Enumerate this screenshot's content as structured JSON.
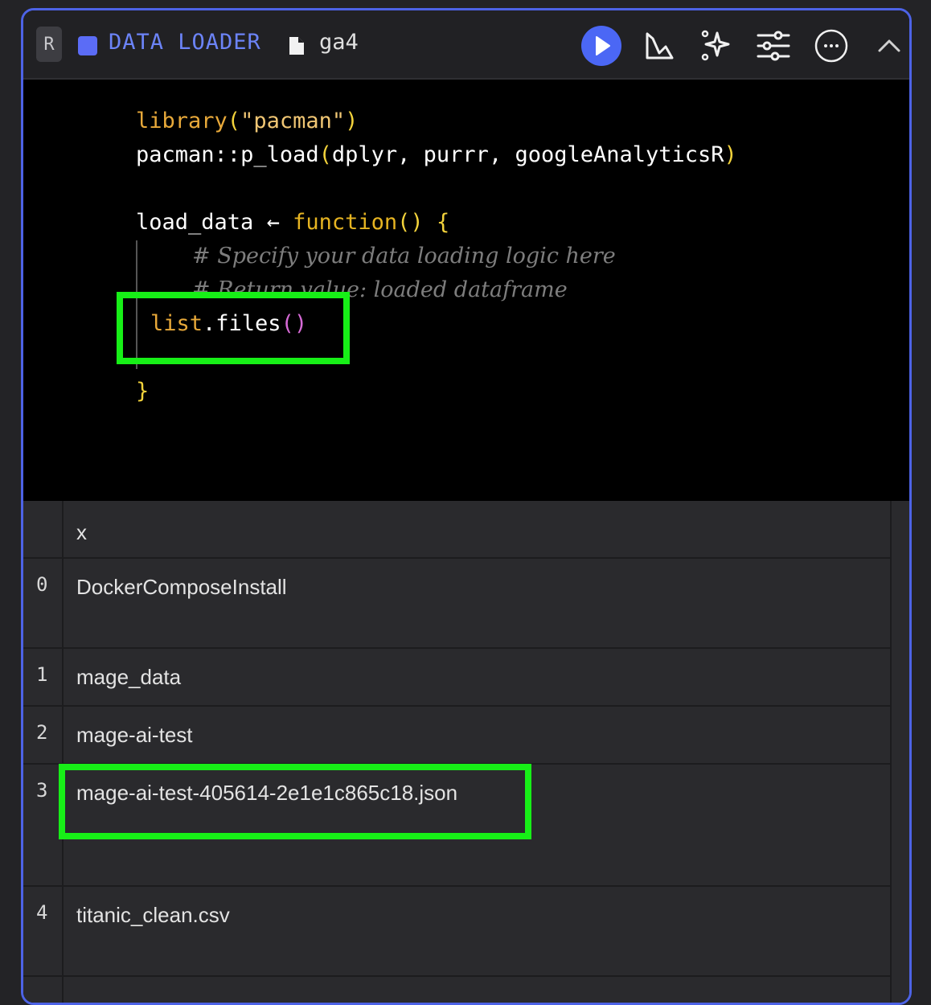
{
  "header": {
    "language_badge": "R",
    "block_type": "DATA LOADER",
    "block_name": "ga4",
    "icons": [
      "file-icon",
      "run-icon",
      "chart-icon",
      "ai-sparkle-icon",
      "settings-sliders-icon",
      "more-options-icon",
      "chevron-up-icon"
    ],
    "accent_color": "#5b6cf6"
  },
  "code": {
    "line1_fn": "library",
    "line1_arg": "\"pacman\"",
    "line2_pkg": "pacman",
    "line2_op": "::",
    "line2_fn": "p_load",
    "line2_args": "dplyr, purrr, googleAnalyticsR",
    "line4_var": "load_data",
    "line4_arrow": "←",
    "line4_kw": "function",
    "comment1": "# Specify your data loading logic here",
    "comment2": "# Return value: loaded dataframe",
    "call_fn": "list",
    "call_method": ".files",
    "call_parens": "()",
    "closing_brace": "}"
  },
  "output": {
    "column_header": "x",
    "rows": [
      {
        "index": "0",
        "value": "DockerComposeInstall"
      },
      {
        "index": "1",
        "value": "mage_data"
      },
      {
        "index": "2",
        "value": "mage-ai-test"
      },
      {
        "index": "3",
        "value": "mage-ai-test-405614-2e1e1c865c18.json"
      },
      {
        "index": "4",
        "value": "titanic_clean.csv"
      }
    ]
  },
  "highlight_color": "#17ef17"
}
